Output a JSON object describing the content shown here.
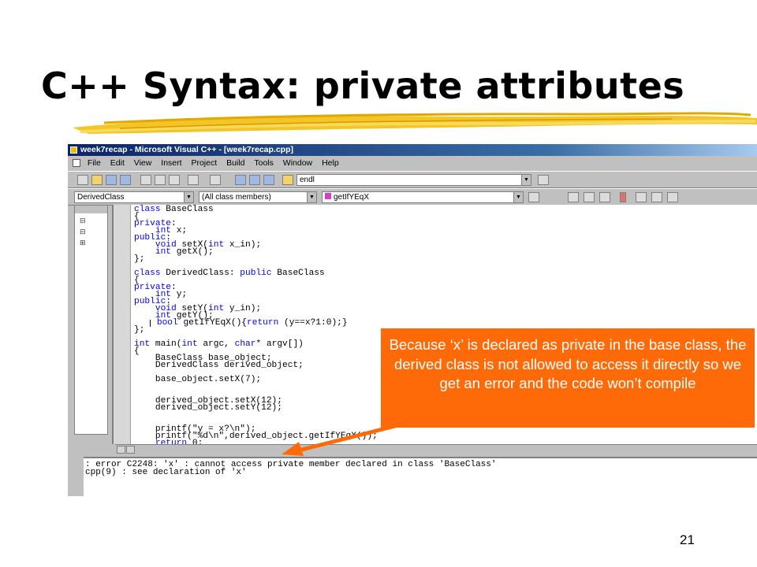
{
  "slide": {
    "title": "C++ Syntax: private attributes",
    "page_number": "21",
    "callout": "Because ‘x’ is declared as private in the base class, the derived class is not allowed to access it directly so we get an error and the code won’t compile"
  },
  "window": {
    "title": "week7recap - Microsoft Visual C++ - [week7recap.cpp]"
  },
  "menu": [
    "File",
    "Edit",
    "View",
    "Insert",
    "Project",
    "Build",
    "Tools",
    "Window",
    "Help"
  ],
  "toolbar": {
    "find_value": "endl",
    "class_combo": "DerivedClass",
    "members_combo": "(All class members)",
    "function_combo": "getIfYEqX"
  },
  "code_lines": [
    "class BaseClass",
    "{",
    "private:",
    "    int x;",
    "public:",
    "    void setX(int x_in);",
    "    int getX();",
    "};",
    "",
    "class DerivedClass: public BaseClass",
    "{",
    "private:",
    "    int y;",
    "public:",
    "    void setY(int y_in);",
    "    int getY();",
    "    bool getIfYEqX(){return (y==x?1:0);}",
    "};",
    "",
    "int main(int argc, char* argv[])",
    "{",
    "    BaseClass base_object;",
    "    DerivedClass derived_object;",
    "",
    "    base_object.setX(7);",
    "",
    "",
    "    derived_object.setX(12);",
    "    derived_object.setY(12);",
    "",
    "",
    "    printf(\"y = x?\\n\");",
    "    printf(\"%d\\n\",derived_object.getIfYEqX());",
    "    return 0;"
  ],
  "output_lines": [
    ": error C2248: 'x' : cannot access private member declared in class 'BaseClass'",
    "cpp(9) : see declaration of 'x'"
  ],
  "colors": {
    "callout": "#ff6a08",
    "keyword": "#0000ff",
    "brush": "#f2c21a"
  }
}
